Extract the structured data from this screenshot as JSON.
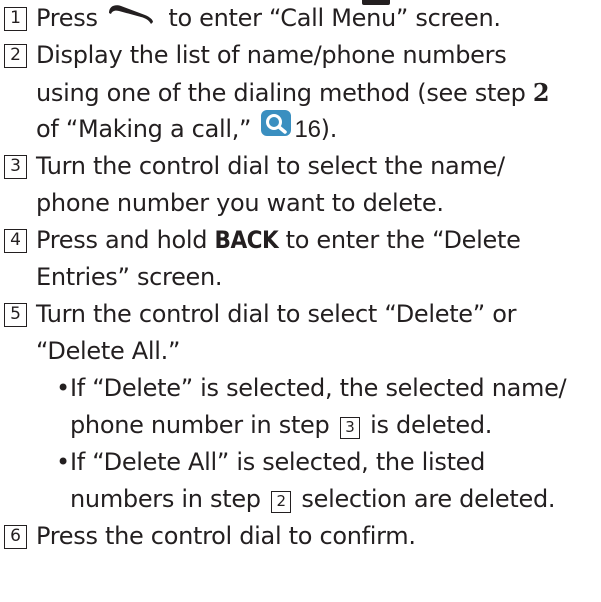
{
  "steps": [
    {
      "number": "1",
      "pre": "Press",
      "icon": "phone-handset-icon",
      "post": "to enter “Call Menu” screen."
    },
    {
      "number": "2",
      "line1": "Display the list of name/phone numbers",
      "line2_pre": "using one of the dialing method (see step",
      "line2_bold": "2",
      "line3_pre": "of “Making a call,”",
      "line3_icon": "search-magnifier-icon",
      "line3_ref": "16",
      "line3_post": ")."
    },
    {
      "number": "3",
      "line1": "Turn the control dial to select the name/",
      "line2": "phone number you want to delete."
    },
    {
      "number": "4",
      "line1_pre": "Press and hold",
      "line1_bold": "BACK",
      "line1_post": "to enter the “Delete",
      "line2": "Entries” screen."
    },
    {
      "number": "5",
      "line1": "Turn the control dial to select “Delete” or",
      "line2": "“Delete All.”",
      "bullets": [
        {
          "line1": "If “Delete” is selected, the selected name/",
          "line2_pre": "phone number in step",
          "line2_box": "3",
          "line2_post": "is deleted."
        },
        {
          "line1": "If “Delete All” is selected, the listed",
          "line2_pre": "numbers in step",
          "line2_box": "2",
          "line2_post": "selection are deleted."
        }
      ]
    },
    {
      "number": "6",
      "line1": "Press the control dial to confirm."
    }
  ],
  "colors": {
    "text": "#231f20",
    "icon_accent": "#3a8fc0"
  },
  "bullet_char": "•"
}
